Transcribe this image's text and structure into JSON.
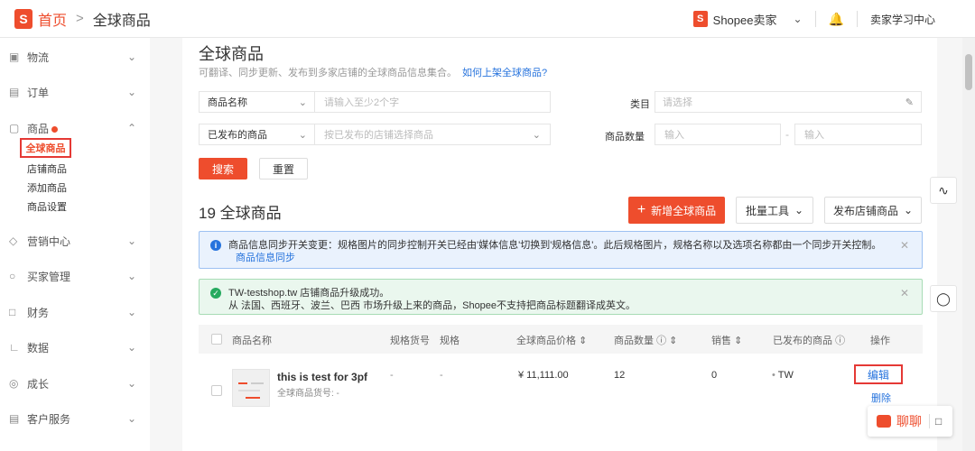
{
  "topbar": {
    "logo_glyph": "S",
    "home": "首页",
    "separator": ">",
    "current": "全球商品",
    "shop_glyph": "S",
    "shop_name": "Shopee卖家",
    "learning_center": "卖家学习中心"
  },
  "sidebar": {
    "logistics": "物流",
    "orders": "订单",
    "products": "商品",
    "sub_items": [
      "全球商品",
      "店铺商品",
      "添加商品",
      "商品设置"
    ],
    "marketing": "营销中心",
    "buyer_management": "买家管理",
    "finance": "财务",
    "data": "数据",
    "growth": "成长",
    "customer_service": "客户服务"
  },
  "main": {
    "title": "全球商品",
    "subtitle": "可翻译、同步更新、发布到多家店铺的全球商品信息集合。",
    "subtitle_link": "如何上架全球商品?",
    "filters": {
      "name_select": "商品名称",
      "name_placeholder": "请输入至少2个字",
      "category_label": "类目",
      "category_placeholder": "请选择",
      "published_select": "已发布的商品",
      "published_placeholder": "按已发布的店铺选择商品",
      "quantity_label": "商品数量",
      "qty_min_placeholder": "输入",
      "qty_dash": "-",
      "qty_max_placeholder": "输入",
      "search_button": "搜索",
      "reset_button": "重置"
    },
    "count_title": "19 全球商品",
    "add_button": "新增全球商品",
    "batch_button": "批量工具",
    "publish_button": "发布店铺商品",
    "info_alert": "商品信息同步开关变更：规格图片的同步控制开关已经由'媒体信息'切换到'规格信息'。此后规格图片，规格名称以及选项名称都由一个同步开关控制。",
    "info_alert_link": "商品信息同步",
    "success_line1": "TW-testshop.tw 店铺商品升级成功。",
    "success_line2": "从 法国、西班牙、波兰、巴西 市场升级上来的商品，Shopee不支持把商品标题翻译成英文。",
    "table": {
      "headers": [
        "商品名称",
        "规格货号",
        "规格",
        "全球商品价格",
        "商品数量",
        "销售",
        "已发布的商品",
        "操作"
      ],
      "row": {
        "name": "this is test for 3pf",
        "sku_label": "全球商品货号: -",
        "variation_sku": "-",
        "variation": "-",
        "price": "¥ 11,111.00",
        "quantity": "12",
        "sales": "0",
        "published": "TW",
        "edit": "编辑",
        "delete": "删除"
      }
    }
  },
  "chat": {
    "label": "聊聊"
  },
  "colors": {
    "brand": "#ee4d2d",
    "link": "#2673dd",
    "info_bg": "#eaf2fd",
    "success_bg": "#eaf7ee"
  }
}
